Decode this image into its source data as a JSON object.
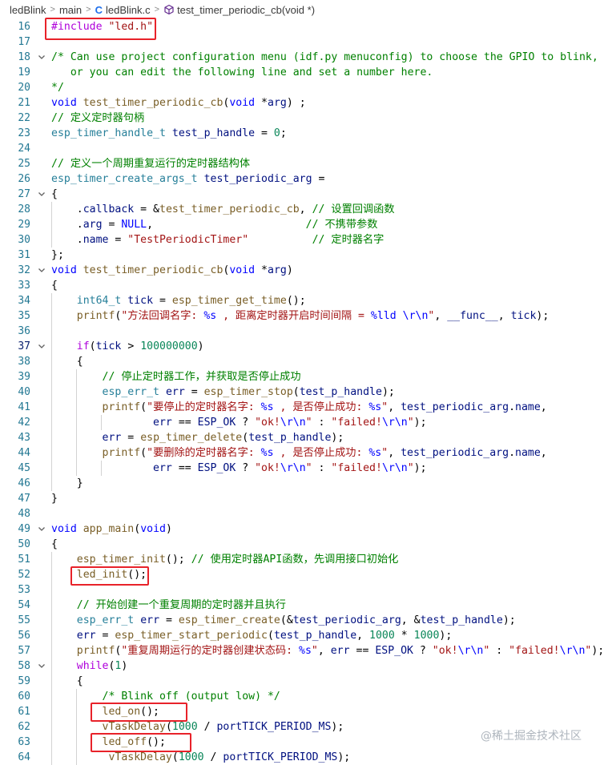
{
  "breadcrumb": {
    "project": "ledBlink",
    "folder": "main",
    "file": "ledBlink.c",
    "file_icon": "C",
    "symbol": "test_timer_periodic_cb(void *)"
  },
  "active_line": "37",
  "code_lines": [
    {
      "ln": "16",
      "fold": false,
      "tokens": [
        {
          "t": "#include",
          "c": "p"
        },
        {
          "t": " "
        },
        {
          "t": "\"led.h\"",
          "c": "s"
        }
      ]
    },
    {
      "ln": "17",
      "fold": false,
      "tokens": []
    },
    {
      "ln": "18",
      "fold": true,
      "tokens": [
        {
          "t": "/* Can use project configuration menu (idf.py menuconfig) to choose the GPIO to blink,",
          "c": "c"
        }
      ]
    },
    {
      "ln": "19",
      "fold": false,
      "tokens": [
        {
          "t": "   or you can edit the following line and set a number here.",
          "c": "c"
        }
      ]
    },
    {
      "ln": "20",
      "fold": false,
      "tokens": [
        {
          "t": "*/",
          "c": "c"
        }
      ]
    },
    {
      "ln": "21",
      "fold": false,
      "tokens": [
        {
          "t": "void",
          "c": "k"
        },
        {
          "t": " "
        },
        {
          "t": "test_timer_periodic_cb",
          "c": "f"
        },
        {
          "t": "("
        },
        {
          "t": "void",
          "c": "k"
        },
        {
          "t": " *"
        },
        {
          "t": "arg",
          "c": "v"
        },
        {
          "t": ") ;"
        }
      ]
    },
    {
      "ln": "22",
      "fold": false,
      "tokens": [
        {
          "t": "// 定义定时器句柄",
          "c": "c"
        }
      ]
    },
    {
      "ln": "23",
      "fold": false,
      "tokens": [
        {
          "t": "esp_timer_handle_t",
          "c": "t"
        },
        {
          "t": " "
        },
        {
          "t": "test_p_handle",
          "c": "v"
        },
        {
          "t": " = "
        },
        {
          "t": "0",
          "c": "n"
        },
        {
          "t": ";"
        }
      ]
    },
    {
      "ln": "24",
      "fold": false,
      "tokens": []
    },
    {
      "ln": "25",
      "fold": false,
      "tokens": [
        {
          "t": "// 定义一个周期重复运行的定时器结构体",
          "c": "c"
        }
      ]
    },
    {
      "ln": "26",
      "fold": false,
      "tokens": [
        {
          "t": "esp_timer_create_args_t",
          "c": "t"
        },
        {
          "t": " "
        },
        {
          "t": "test_periodic_arg",
          "c": "v"
        },
        {
          "t": " ="
        }
      ]
    },
    {
      "ln": "27",
      "fold": true,
      "tokens": [
        {
          "t": "{"
        }
      ]
    },
    {
      "ln": "28",
      "fold": false,
      "tokens": [
        {
          "t": "    ."
        },
        {
          "t": "callback",
          "c": "v"
        },
        {
          "t": " = &"
        },
        {
          "t": "test_timer_periodic_cb",
          "c": "f"
        },
        {
          "t": ", "
        },
        {
          "t": "// 设置回调函数",
          "c": "c"
        }
      ]
    },
    {
      "ln": "29",
      "fold": false,
      "tokens": [
        {
          "t": "    ."
        },
        {
          "t": "arg",
          "c": "v"
        },
        {
          "t": " = "
        },
        {
          "t": "NULL",
          "c": "k"
        },
        {
          "t": ",                        "
        },
        {
          "t": "// 不携带参数",
          "c": "c"
        }
      ]
    },
    {
      "ln": "30",
      "fold": false,
      "tokens": [
        {
          "t": "    ."
        },
        {
          "t": "name",
          "c": "v"
        },
        {
          "t": " = "
        },
        {
          "t": "\"TestPeriodicTimer\"",
          "c": "s"
        },
        {
          "t": "          "
        },
        {
          "t": "// 定时器名字",
          "c": "c"
        }
      ]
    },
    {
      "ln": "31",
      "fold": false,
      "tokens": [
        {
          "t": "};"
        }
      ]
    },
    {
      "ln": "32",
      "fold": true,
      "tokens": [
        {
          "t": "void",
          "c": "k"
        },
        {
          "t": " "
        },
        {
          "t": "test_timer_periodic_cb",
          "c": "f"
        },
        {
          "t": "("
        },
        {
          "t": "void",
          "c": "k"
        },
        {
          "t": " *"
        },
        {
          "t": "arg",
          "c": "v"
        },
        {
          "t": ")"
        }
      ]
    },
    {
      "ln": "33",
      "fold": false,
      "tokens": [
        {
          "t": "{"
        }
      ]
    },
    {
      "ln": "34",
      "fold": false,
      "tokens": [
        {
          "t": "    "
        },
        {
          "t": "int64_t",
          "c": "t"
        },
        {
          "t": " "
        },
        {
          "t": "tick",
          "c": "v"
        },
        {
          "t": " = "
        },
        {
          "t": "esp_timer_get_time",
          "c": "f"
        },
        {
          "t": "();"
        }
      ]
    },
    {
      "ln": "35",
      "fold": false,
      "tokens": [
        {
          "t": "    "
        },
        {
          "t": "printf",
          "c": "f"
        },
        {
          "t": "("
        },
        {
          "t": "\"方法回调名字: ",
          "c": "s"
        },
        {
          "t": "%s",
          "c": "k"
        },
        {
          "t": " , 距离定时器开启时间间隔 = ",
          "c": "s"
        },
        {
          "t": "%lld",
          "c": "k"
        },
        {
          "t": " ",
          "c": "s"
        },
        {
          "t": "\\r\\n",
          "c": "k"
        },
        {
          "t": "\"",
          "c": "s"
        },
        {
          "t": ", "
        },
        {
          "t": "__func__",
          "c": "v"
        },
        {
          "t": ", "
        },
        {
          "t": "tick",
          "c": "v"
        },
        {
          "t": ");"
        }
      ]
    },
    {
      "ln": "36",
      "fold": false,
      "tokens": []
    },
    {
      "ln": "37",
      "fold": true,
      "tokens": [
        {
          "t": "    "
        },
        {
          "t": "if",
          "c": "p"
        },
        {
          "t": "("
        },
        {
          "t": "tick",
          "c": "v"
        },
        {
          "t": " > "
        },
        {
          "t": "100000000",
          "c": "n"
        },
        {
          "t": ")"
        }
      ]
    },
    {
      "ln": "38",
      "fold": false,
      "tokens": [
        {
          "t": "    {"
        }
      ]
    },
    {
      "ln": "39",
      "fold": false,
      "tokens": [
        {
          "t": "        "
        },
        {
          "t": "// 停止定时器工作，并获取是否停止成功",
          "c": "c"
        }
      ]
    },
    {
      "ln": "40",
      "fold": false,
      "tokens": [
        {
          "t": "        "
        },
        {
          "t": "esp_err_t",
          "c": "t"
        },
        {
          "t": " "
        },
        {
          "t": "err",
          "c": "v"
        },
        {
          "t": " = "
        },
        {
          "t": "esp_timer_stop",
          "c": "f"
        },
        {
          "t": "("
        },
        {
          "t": "test_p_handle",
          "c": "v"
        },
        {
          "t": ");"
        }
      ]
    },
    {
      "ln": "41",
      "fold": false,
      "tokens": [
        {
          "t": "        "
        },
        {
          "t": "printf",
          "c": "f"
        },
        {
          "t": "("
        },
        {
          "t": "\"要停止的定时器名字: ",
          "c": "s"
        },
        {
          "t": "%s",
          "c": "k"
        },
        {
          "t": " , 是否停止成功: ",
          "c": "s"
        },
        {
          "t": "%s",
          "c": "k"
        },
        {
          "t": "\"",
          "c": "s"
        },
        {
          "t": ", "
        },
        {
          "t": "test_periodic_arg",
          "c": "v"
        },
        {
          "t": "."
        },
        {
          "t": "name",
          "c": "v"
        },
        {
          "t": ","
        }
      ]
    },
    {
      "ln": "42",
      "fold": false,
      "tokens": [
        {
          "t": "                "
        },
        {
          "t": "err",
          "c": "v"
        },
        {
          "t": " == "
        },
        {
          "t": "ESP_OK",
          "c": "v"
        },
        {
          "t": " ? "
        },
        {
          "t": "\"ok!",
          "c": "s"
        },
        {
          "t": "\\r\\n",
          "c": "k"
        },
        {
          "t": "\"",
          "c": "s"
        },
        {
          "t": " : "
        },
        {
          "t": "\"failed!",
          "c": "s"
        },
        {
          "t": "\\r\\n",
          "c": "k"
        },
        {
          "t": "\"",
          "c": "s"
        },
        {
          "t": ");"
        }
      ]
    },
    {
      "ln": "43",
      "fold": false,
      "tokens": [
        {
          "t": "        "
        },
        {
          "t": "err",
          "c": "v"
        },
        {
          "t": " = "
        },
        {
          "t": "esp_timer_delete",
          "c": "f"
        },
        {
          "t": "("
        },
        {
          "t": "test_p_handle",
          "c": "v"
        },
        {
          "t": ");"
        }
      ]
    },
    {
      "ln": "44",
      "fold": false,
      "tokens": [
        {
          "t": "        "
        },
        {
          "t": "printf",
          "c": "f"
        },
        {
          "t": "("
        },
        {
          "t": "\"要删除的定时器名字: ",
          "c": "s"
        },
        {
          "t": "%s",
          "c": "k"
        },
        {
          "t": " , 是否停止成功: ",
          "c": "s"
        },
        {
          "t": "%s",
          "c": "k"
        },
        {
          "t": "\"",
          "c": "s"
        },
        {
          "t": ", "
        },
        {
          "t": "test_periodic_arg",
          "c": "v"
        },
        {
          "t": "."
        },
        {
          "t": "name",
          "c": "v"
        },
        {
          "t": ","
        }
      ]
    },
    {
      "ln": "45",
      "fold": false,
      "tokens": [
        {
          "t": "                "
        },
        {
          "t": "err",
          "c": "v"
        },
        {
          "t": " == "
        },
        {
          "t": "ESP_OK",
          "c": "v"
        },
        {
          "t": " ? "
        },
        {
          "t": "\"ok!",
          "c": "s"
        },
        {
          "t": "\\r\\n",
          "c": "k"
        },
        {
          "t": "\"",
          "c": "s"
        },
        {
          "t": " : "
        },
        {
          "t": "\"failed!",
          "c": "s"
        },
        {
          "t": "\\r\\n",
          "c": "k"
        },
        {
          "t": "\"",
          "c": "s"
        },
        {
          "t": ");"
        }
      ]
    },
    {
      "ln": "46",
      "fold": false,
      "tokens": [
        {
          "t": "    }"
        }
      ]
    },
    {
      "ln": "47",
      "fold": false,
      "tokens": [
        {
          "t": "}"
        }
      ]
    },
    {
      "ln": "48",
      "fold": false,
      "tokens": []
    },
    {
      "ln": "49",
      "fold": true,
      "tokens": [
        {
          "t": "void",
          "c": "k"
        },
        {
          "t": " "
        },
        {
          "t": "app_main",
          "c": "f"
        },
        {
          "t": "("
        },
        {
          "t": "void",
          "c": "k"
        },
        {
          "t": ")"
        }
      ]
    },
    {
      "ln": "50",
      "fold": false,
      "tokens": [
        {
          "t": "{"
        }
      ]
    },
    {
      "ln": "51",
      "fold": false,
      "tokens": [
        {
          "t": "    "
        },
        {
          "t": "esp_timer_init",
          "c": "f"
        },
        {
          "t": "(); "
        },
        {
          "t": "// 使用定时器API函数，先调用接口初始化",
          "c": "c"
        }
      ]
    },
    {
      "ln": "52",
      "fold": false,
      "tokens": [
        {
          "t": "    "
        },
        {
          "t": "led_init",
          "c": "f"
        },
        {
          "t": "();"
        }
      ]
    },
    {
      "ln": "53",
      "fold": false,
      "tokens": []
    },
    {
      "ln": "54",
      "fold": false,
      "tokens": [
        {
          "t": "    "
        },
        {
          "t": "// 开始创建一个重复周期的定时器并且执行",
          "c": "c"
        }
      ]
    },
    {
      "ln": "55",
      "fold": false,
      "tokens": [
        {
          "t": "    "
        },
        {
          "t": "esp_err_t",
          "c": "t"
        },
        {
          "t": " "
        },
        {
          "t": "err",
          "c": "v"
        },
        {
          "t": " = "
        },
        {
          "t": "esp_timer_create",
          "c": "f"
        },
        {
          "t": "(&"
        },
        {
          "t": "test_periodic_arg",
          "c": "v"
        },
        {
          "t": ", &"
        },
        {
          "t": "test_p_handle",
          "c": "v"
        },
        {
          "t": ");"
        }
      ]
    },
    {
      "ln": "56",
      "fold": false,
      "tokens": [
        {
          "t": "    "
        },
        {
          "t": "err",
          "c": "v"
        },
        {
          "t": " = "
        },
        {
          "t": "esp_timer_start_periodic",
          "c": "f"
        },
        {
          "t": "("
        },
        {
          "t": "test_p_handle",
          "c": "v"
        },
        {
          "t": ", "
        },
        {
          "t": "1000",
          "c": "n"
        },
        {
          "t": " * "
        },
        {
          "t": "1000",
          "c": "n"
        },
        {
          "t": ");"
        }
      ]
    },
    {
      "ln": "57",
      "fold": false,
      "tokens": [
        {
          "t": "    "
        },
        {
          "t": "printf",
          "c": "f"
        },
        {
          "t": "("
        },
        {
          "t": "\"重复周期运行的定时器创建状态码: ",
          "c": "s"
        },
        {
          "t": "%s",
          "c": "k"
        },
        {
          "t": "\"",
          "c": "s"
        },
        {
          "t": ", "
        },
        {
          "t": "err",
          "c": "v"
        },
        {
          "t": " == "
        },
        {
          "t": "ESP_OK",
          "c": "v"
        },
        {
          "t": " ? "
        },
        {
          "t": "\"ok!",
          "c": "s"
        },
        {
          "t": "\\r\\n",
          "c": "k"
        },
        {
          "t": "\"",
          "c": "s"
        },
        {
          "t": " : "
        },
        {
          "t": "\"failed!",
          "c": "s"
        },
        {
          "t": "\\r\\n",
          "c": "k"
        },
        {
          "t": "\"",
          "c": "s"
        },
        {
          "t": ");"
        }
      ]
    },
    {
      "ln": "58",
      "fold": true,
      "tokens": [
        {
          "t": "    "
        },
        {
          "t": "while",
          "c": "p"
        },
        {
          "t": "("
        },
        {
          "t": "1",
          "c": "n"
        },
        {
          "t": ")"
        }
      ]
    },
    {
      "ln": "59",
      "fold": false,
      "tokens": [
        {
          "t": "    {"
        }
      ]
    },
    {
      "ln": "60",
      "fold": false,
      "tokens": [
        {
          "t": "        "
        },
        {
          "t": "/* Blink off (output low) */",
          "c": "c"
        }
      ]
    },
    {
      "ln": "61",
      "fold": false,
      "tokens": [
        {
          "t": "        "
        },
        {
          "t": "led_on",
          "c": "f"
        },
        {
          "t": "();"
        }
      ]
    },
    {
      "ln": "62",
      "fold": false,
      "tokens": [
        {
          "t": "        "
        },
        {
          "t": "vTaskDelay",
          "c": "f"
        },
        {
          "t": "("
        },
        {
          "t": "1000",
          "c": "n"
        },
        {
          "t": " / "
        },
        {
          "t": "portTICK_PERIOD_MS",
          "c": "v"
        },
        {
          "t": ");"
        }
      ]
    },
    {
      "ln": "63",
      "fold": false,
      "tokens": [
        {
          "t": "        "
        },
        {
          "t": "led_off",
          "c": "f"
        },
        {
          "t": "();"
        }
      ]
    },
    {
      "ln": "64",
      "fold": false,
      "tokens": [
        {
          "t": "         "
        },
        {
          "t": "vTaskDelay",
          "c": "f"
        },
        {
          "t": "("
        },
        {
          "t": "1000",
          "c": "n"
        },
        {
          "t": " / "
        },
        {
          "t": "portTICK_PERIOD_MS",
          "c": "v"
        },
        {
          "t": ");"
        }
      ]
    }
  ],
  "watermark": "@稀土掘金技术社区",
  "colors": {
    "annotation_box": "#e8222a",
    "keyword": "#0000ff",
    "type": "#267f99",
    "function": "#795e26",
    "string": "#a31515",
    "comment": "#008000",
    "control": "#af00db",
    "variable": "#001080",
    "number": "#098658",
    "line_number": "#237893"
  }
}
